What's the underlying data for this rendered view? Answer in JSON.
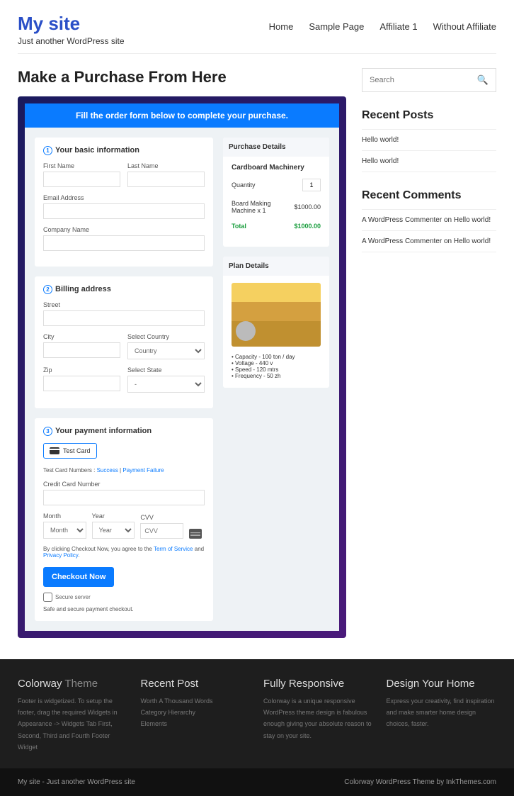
{
  "site": {
    "title": "My site",
    "tagline": "Just another WordPress site"
  },
  "nav": [
    "Home",
    "Sample Page",
    "Affiliate 1",
    "Without Affiliate"
  ],
  "page_title": "Make a Purchase From Here",
  "form": {
    "banner": "Fill the order form below to complete your purchase.",
    "s1": {
      "title": "Your basic information",
      "first_name": "First Name",
      "last_name": "Last Name",
      "email": "Email Address",
      "company": "Company Name"
    },
    "s2": {
      "title": "Billing address",
      "street": "Street",
      "city": "City",
      "country": "Select Country",
      "country_ph": "Country",
      "zip": "Zip",
      "state": "Select State",
      "state_ph": "-"
    },
    "s3": {
      "title": "Your payment information",
      "test_card": "Test  Card",
      "tcn_label": "Test Card Numbers :",
      "success": "Success",
      "sep": " | ",
      "failure": "Payment Failure",
      "cc_label": "Credit Card Number",
      "month": "Month",
      "month_ph": "Month",
      "year": "Year",
      "year_ph": "Year",
      "cvv": "CVV",
      "cvv_ph": "CVV",
      "agree1": "By clicking Checkout Now, you agree to the ",
      "tos": "Term of Service",
      "and": " and ",
      "pp": "Privacy Policy",
      "checkout": "Checkout Now",
      "secure": "Secure server",
      "safe": "Safe and secure payment checkout."
    },
    "pd": {
      "head": "Purchase Details",
      "product": "Cardboard Machinery",
      "qty_label": "Quantity",
      "qty": "1",
      "line": "Board Making Machine x 1",
      "line_price": "$1000.00",
      "total_label": "Total",
      "total": "$1000.00"
    },
    "plan": {
      "head": "Plan Details",
      "specs": [
        "Capacity - 100 ton / day",
        "Voltage - 440 v",
        "Speed - 120 mtrs",
        "Frequency - 50 zh"
      ]
    }
  },
  "search_ph": "Search",
  "recent_posts": {
    "title": "Recent Posts",
    "items": [
      "Hello world!",
      "Hello world!"
    ]
  },
  "recent_comments": {
    "title": "Recent Comments",
    "items": [
      "A WordPress Commenter on Hello world!",
      "A WordPress Commenter on Hello world!"
    ]
  },
  "footer": {
    "cols": [
      {
        "t1": "Colorway ",
        "t2": "Theme",
        "txt": "Footer is widgetized. To setup the footer, drag the required Widgets in Appearance -> Widgets Tab First, Second, Third and Fourth Footer Widget"
      },
      {
        "t1": "Recent Post",
        "t2": "",
        "txt": "Worth A Thousand Words\nCategory Hierarchy\nElements"
      },
      {
        "t1": "Fully Responsive",
        "t2": "",
        "txt": "Colorway is a unique responsive WordPress theme design is fabulous enough giving your absolute reason to stay on your site."
      },
      {
        "t1": "Design Your Home",
        "t2": "",
        "txt": "Express your creativity, find inspiration and make smarter home design choices, faster."
      }
    ],
    "bar_left": "My site - Just another WordPress site",
    "bar_right": "Colorway WordPress Theme by InkThemes.com"
  }
}
